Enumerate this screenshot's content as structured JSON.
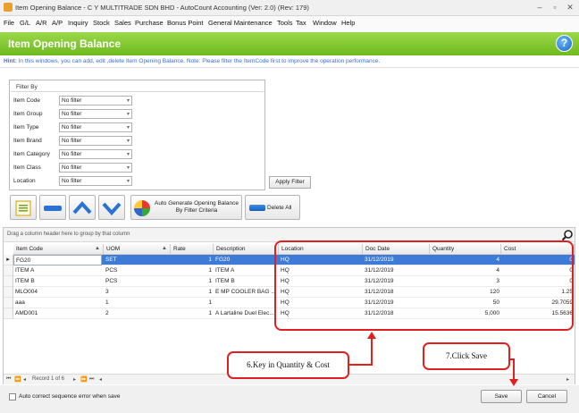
{
  "window": {
    "title": "Item Opening Balance - C Y MULTITRADE SDN BHD - AutoCount Accounting (Ver: 2.0) (Rev: 179)",
    "minimize": "–",
    "restore": "▫",
    "close": "✕"
  },
  "menu": [
    "File",
    "G/L",
    "A/R",
    "A/P",
    "Inquiry",
    "Stock",
    "Sales",
    "Purchase",
    "Bonus Point",
    "General Maintenance",
    "Tools",
    "Tax",
    "Window",
    "Help"
  ],
  "header": {
    "title": "Item Opening Balance",
    "help": "?"
  },
  "hint": {
    "label": "Hint:",
    "text": " In this windows, you can add, edit ,delete Item Opening Balance. Note: Please filter the ItemCode first to improve the operation performance."
  },
  "filter": {
    "legend": "Filter By",
    "rows": [
      {
        "label": "Item Code",
        "value": "No filter"
      },
      {
        "label": "Item Group",
        "value": "No filter"
      },
      {
        "label": "Item Type",
        "value": "No filter"
      },
      {
        "label": "Item Brand",
        "value": "No filter"
      },
      {
        "label": "Item Category",
        "value": "No filter"
      },
      {
        "label": "Item Class",
        "value": "No filter"
      },
      {
        "label": "Location",
        "value": "No filter"
      }
    ],
    "apply": "Apply Filter"
  },
  "toolbar": {
    "generate_line1": "Auto Generate Opening Balance",
    "generate_line2": "By Filter Criteria",
    "delete_all": "Delete All"
  },
  "grid": {
    "group_hint": "Drag a column header here to group by that column",
    "columns": [
      "Item Code",
      "UOM",
      "Rate",
      "Description",
      "Location",
      "Doc Date",
      "Quantity",
      "Cost"
    ],
    "rows": [
      [
        "FG20",
        "SET",
        "1",
        "FG20",
        "HQ",
        "31/12/2019",
        "4",
        "0"
      ],
      [
        "ITEM A",
        "PCS",
        "1",
        "ITEM A",
        "HQ",
        "31/12/2019",
        "4",
        "0"
      ],
      [
        "ITEM B",
        "PCS",
        "1",
        "ITEM B",
        "HQ",
        "31/12/2019",
        "3",
        "0"
      ],
      [
        "MLO004",
        "3",
        "1",
        "E MP COOLER BAG ...",
        "HQ",
        "31/12/2018",
        "120",
        "1.25"
      ],
      [
        "aaa",
        "1",
        "1",
        "",
        "HQ",
        "31/12/2019",
        "50",
        "29.7059"
      ],
      [
        "AMD001",
        "2",
        "1",
        "A Lartaline Duel Elec...",
        "HQ",
        "31/12/2018",
        "5,000",
        "15.5636"
      ]
    ],
    "record": "Record 1 of 6"
  },
  "footer": {
    "auto_correct": "Auto correct sequence error when save",
    "save": "Save",
    "cancel": "Cancel"
  },
  "annotations": {
    "step6": "6.Key in Quantity & Cost",
    "step7": "7.Click Save"
  }
}
